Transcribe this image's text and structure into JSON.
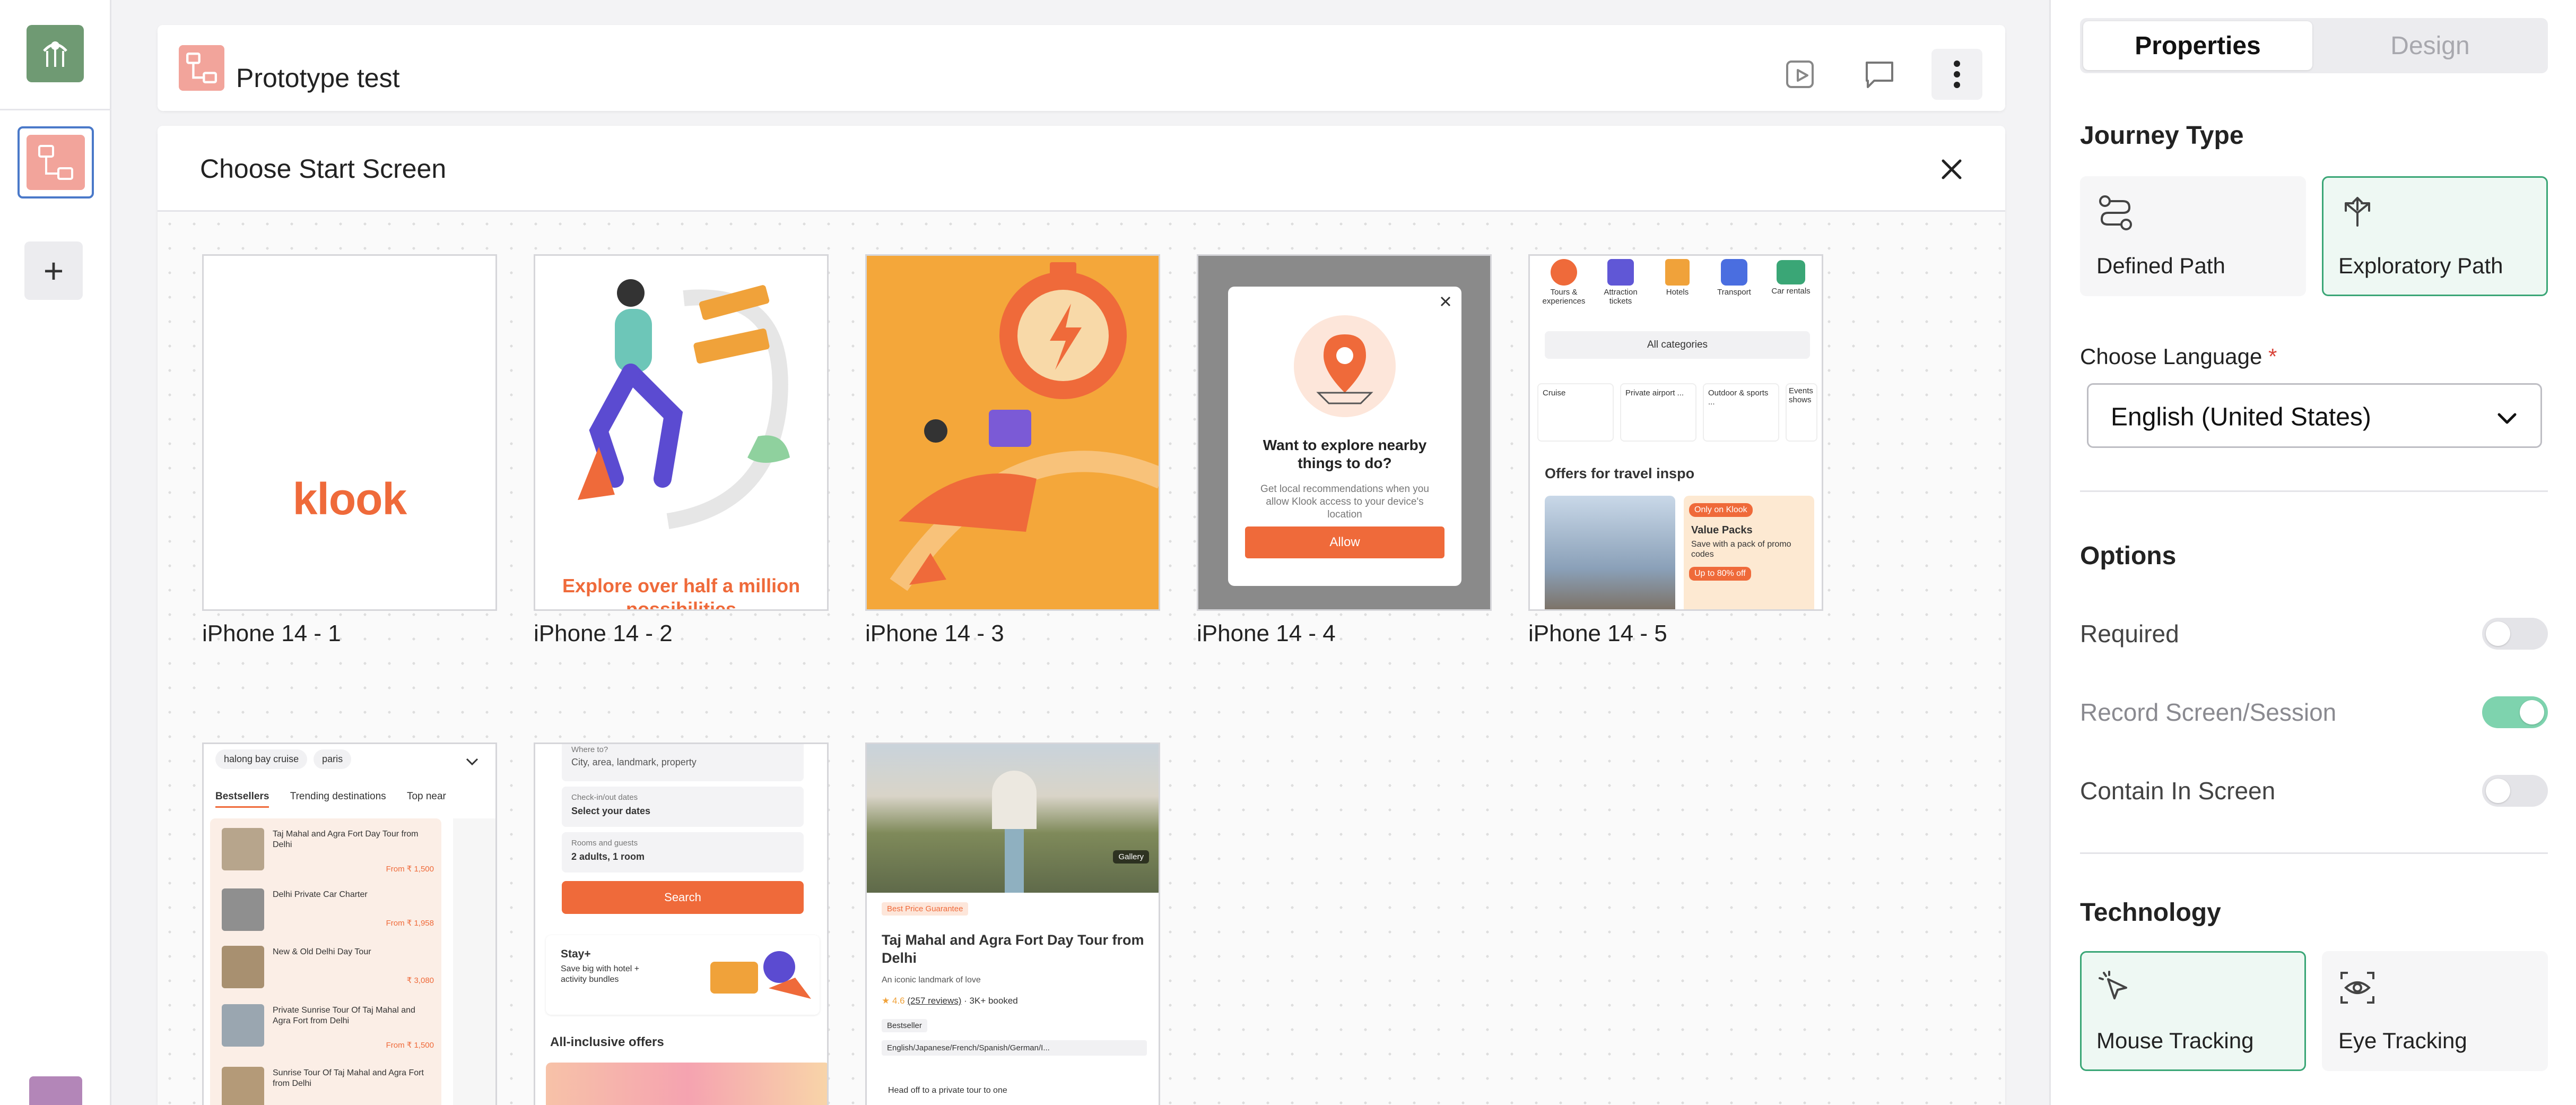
{
  "header": {
    "title": "Prototype test"
  },
  "start_screen_panel": {
    "title": "Choose Start Screen",
    "screens": [
      {
        "label": "iPhone 14 - 1",
        "preview_text": "klook"
      },
      {
        "label": "iPhone 14 - 2",
        "preview_text": "Explore over half a million possibilities"
      },
      {
        "label": "iPhone 14 - 3"
      },
      {
        "label": "iPhone 14 - 4",
        "preview_title": "Want to explore nearby things to do?",
        "preview_sub": "Get local recommendations when you allow Klook access to your device's location",
        "preview_button": "Allow"
      },
      {
        "label": "iPhone 14 - 5",
        "categories": [
          "Tours & experiences",
          "Attraction tickets",
          "Hotels",
          "Transport",
          "Car rentals"
        ],
        "all_categories": "All categories",
        "chips": [
          "Cruise",
          "Private airport ...",
          "Outdoor & sports ...",
          "Events shows"
        ],
        "section": "Offers for travel inspo",
        "promo_badge": "Only on Klook",
        "promo_title": "Value Packs",
        "promo_sub": "Save with a pack of promo codes",
        "promo_tag": "Up to 80% off"
      },
      {
        "label": "",
        "chips": [
          "halong bay cruise",
          "paris"
        ],
        "tabs": [
          "Bestsellers",
          "Trending destinations",
          "Top near"
        ],
        "items": [
          {
            "title": "Taj Mahal and Agra Fort Day Tour from Delhi",
            "price": "From ₹ 1,500"
          },
          {
            "title": "Delhi Private Car Charter",
            "price": "From ₹ 1,958"
          },
          {
            "title": "New & Old Delhi Day Tour",
            "price": "₹ 3,080"
          },
          {
            "title": "Private Sunrise Tour Of Taj Mahal and Agra Fort from Delhi",
            "price": "From ₹ 1,500"
          },
          {
            "title": "Sunrise Tour Of Taj Mahal and Agra Fort from Delhi",
            "price": ""
          }
        ]
      },
      {
        "label": "",
        "where_label": "Where to?",
        "where_placeholder": "City, area, landmark, property",
        "dates_label": "Check-in/out dates",
        "dates_value": "Select your dates",
        "guests_label": "Rooms and guests",
        "guests_value": "2 adults, 1 room",
        "search_button": "Search",
        "stay_title": "Stay+",
        "stay_sub": "Save big with hotel + activity bundles",
        "offers_title": "All-inclusive offers"
      },
      {
        "label": "",
        "gallery": "Gallery",
        "badge": "Best Price Guarantee",
        "title": "Taj Mahal and Agra Fort Day Tour from Delhi",
        "sub": "An iconic landmark of love",
        "rating": "4.6",
        "reviews": "(257 reviews)",
        "booked": "· 3K+ booked",
        "tag": "Bestseller",
        "langs": "English/Japanese/French/Spanish/German/I...",
        "bullet": "Head off to a private tour to one"
      }
    ]
  },
  "properties": {
    "tabs": {
      "active": "Properties",
      "inactive": "Design"
    },
    "journey_type": {
      "title": "Journey Type",
      "options": [
        {
          "label": "Defined Path",
          "selected": false
        },
        {
          "label": "Exploratory Path",
          "selected": true
        }
      ]
    },
    "language": {
      "label": "Choose Language",
      "required_mark": "*",
      "value": "English (United States)"
    },
    "options": {
      "title": "Options",
      "toggles": [
        {
          "label": "Required",
          "on": false
        },
        {
          "label": "Record Screen/Session",
          "on": true
        },
        {
          "label": "Contain In Screen",
          "on": false
        }
      ]
    },
    "technology": {
      "title": "Technology",
      "options": [
        {
          "label": "Mouse Tracking",
          "selected": true
        },
        {
          "label": "Eye Tracking",
          "selected": false
        }
      ]
    }
  },
  "colors": {
    "accent": "#3aa676",
    "brand_orange": "#ef6a3a",
    "prototype_icon": "#f2a49b"
  }
}
